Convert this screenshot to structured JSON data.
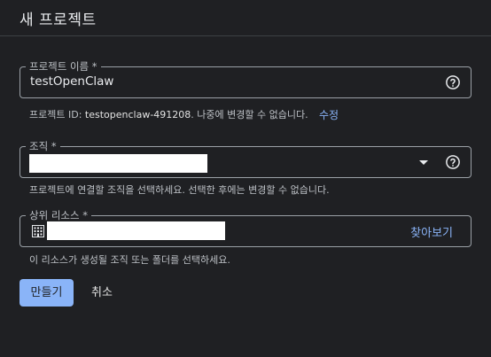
{
  "dialog": {
    "title": "새 프로젝트"
  },
  "project_name": {
    "label": "프로젝트 이름 *",
    "value": "testOpenClaw",
    "help_icon": "help-circle-icon",
    "hint_prefix": "프로젝트 ID: ",
    "project_id": "testopenclaw-491208",
    "hint_suffix": ". 나중에 변경할 수 없습니다.",
    "edit_label": "수정"
  },
  "organization": {
    "label": "조직 *",
    "help_icon": "help-circle-icon",
    "hint": "프로젝트에 연결할 조직을 선택하세요. 선택한 후에는 변경할 수 없습니다."
  },
  "parent_resource": {
    "label": "상위 리소스 *",
    "icon": "building-icon",
    "browse_label": "찾아보기",
    "hint": "이 리소스가 생성될 조직 또는 폴더를 선택하세요."
  },
  "actions": {
    "create_label": "만들기",
    "cancel_label": "취소"
  },
  "colors": {
    "background": "#1f2023",
    "accent": "#8ab4f8",
    "border": "#9aa0a6"
  }
}
